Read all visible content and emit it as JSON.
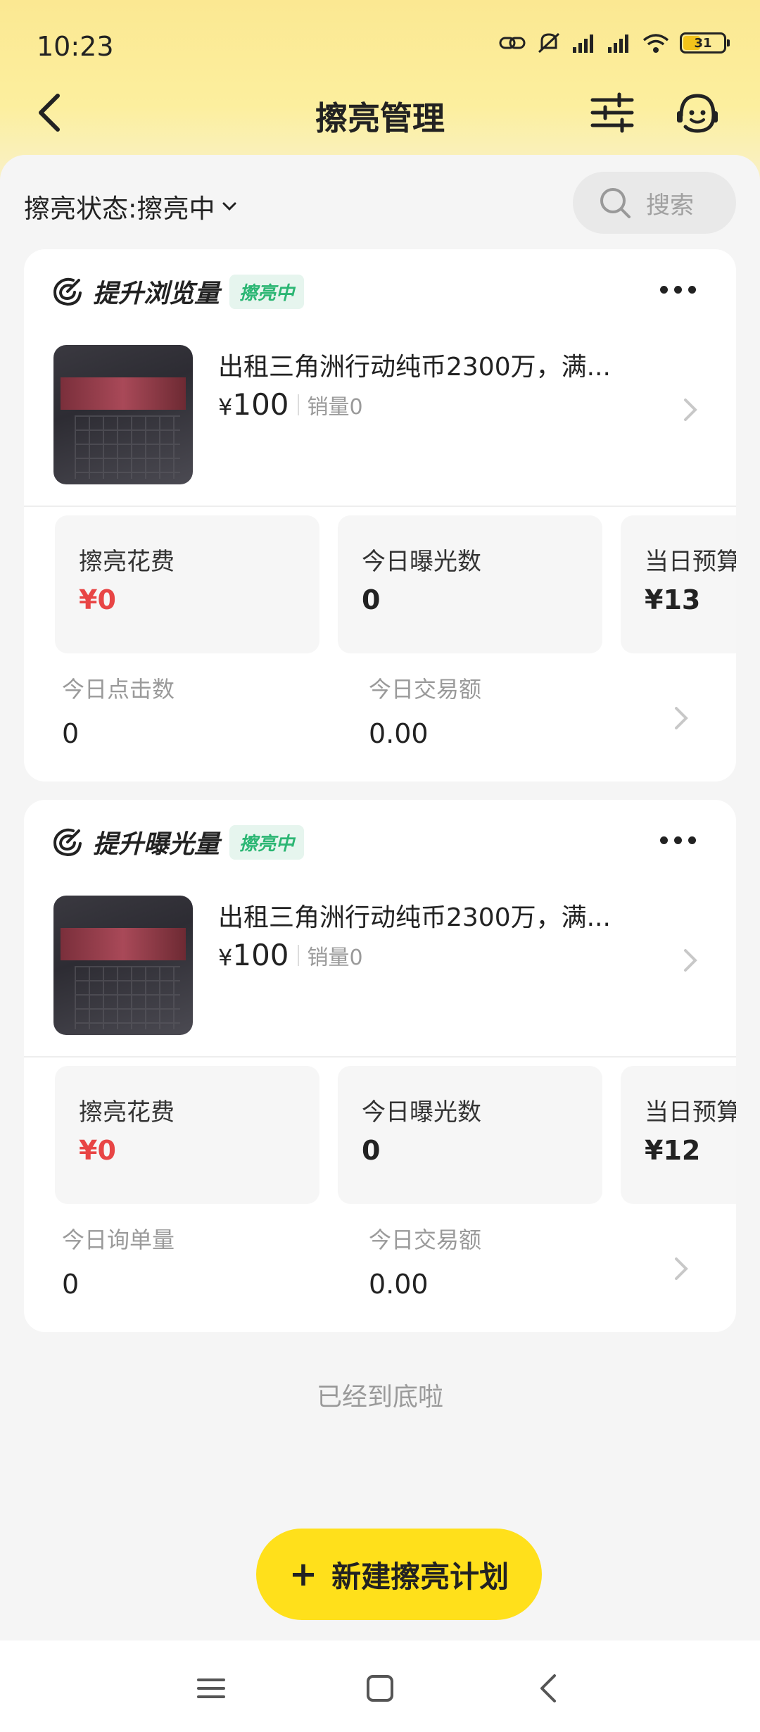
{
  "status_bar": {
    "time": "10:23",
    "battery": "31"
  },
  "nav": {
    "title": "擦亮管理"
  },
  "filter": {
    "label": "擦亮状态:擦亮中",
    "search_placeholder": "搜索"
  },
  "cards": [
    {
      "title": "提升浏览量",
      "status": "擦亮中",
      "product": {
        "title": "出租三角洲行动纯币2300万，满...",
        "price_symbol": "¥",
        "price": "100",
        "sales": "销量0"
      },
      "stats": [
        {
          "label": "擦亮花费",
          "value": "¥0"
        },
        {
          "label": "今日曝光数",
          "value": "0"
        },
        {
          "label": "当日预算",
          "value": "¥13"
        }
      ],
      "metrics": [
        {
          "label": "今日点击数",
          "value": "0"
        },
        {
          "label": "今日交易额",
          "value": "0.00"
        }
      ]
    },
    {
      "title": "提升曝光量",
      "status": "擦亮中",
      "product": {
        "title": "出租三角洲行动纯币2300万，满...",
        "price_symbol": "¥",
        "price": "100",
        "sales": "销量0"
      },
      "stats": [
        {
          "label": "擦亮花费",
          "value": "¥0"
        },
        {
          "label": "今日曝光数",
          "value": "0"
        },
        {
          "label": "当日预算",
          "value": "¥12"
        }
      ],
      "metrics": [
        {
          "label": "今日询单量",
          "value": "0"
        },
        {
          "label": "今日交易额",
          "value": "0.00"
        }
      ]
    }
  ],
  "footer": {
    "end_text": "已经到底啦",
    "create_button": "新建擦亮计划",
    "create_icon": "+"
  },
  "colors": {
    "accent_yellow": "#ffe01b",
    "status_green": "#2bb673",
    "cost_red": "#e84545"
  }
}
